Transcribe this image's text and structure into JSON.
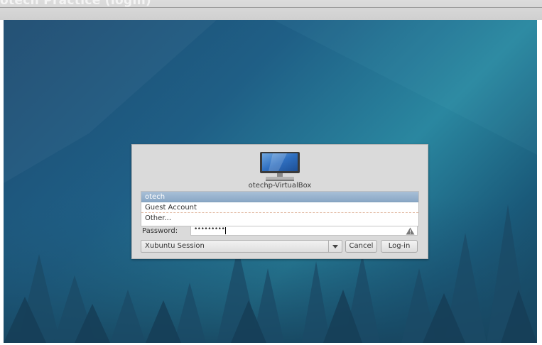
{
  "window": {
    "title": "otech Practice (login)"
  },
  "greeter": {
    "hostname": "otechp-VirtualBox",
    "users": [
      {
        "label": "otech",
        "selected": true
      },
      {
        "label": "Guest Account",
        "selected": false
      },
      {
        "label": "Other...",
        "selected": false
      }
    ],
    "password_label": "Password:",
    "password_mask": "•••••••••",
    "session": "Xubuntu Session",
    "cancel_label": "Cancel",
    "login_label": "Log-in"
  },
  "icons": [
    "computer-icon",
    "warning-icon",
    "dropdown-arrow-icon"
  ],
  "colors": {
    "selection": "#94b0cc",
    "dialog_bg": "#dadada",
    "desktop_blue": "#1f5f86"
  }
}
